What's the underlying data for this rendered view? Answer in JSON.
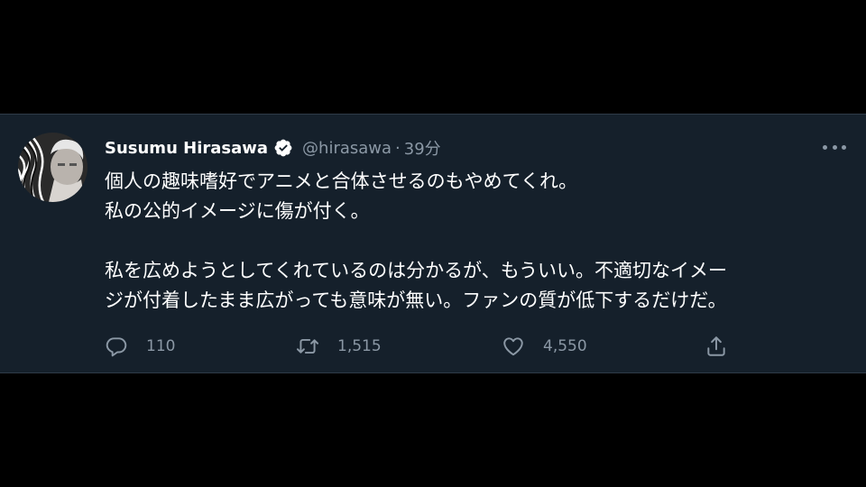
{
  "tweet": {
    "author": {
      "display_name": "Susumu Hirasawa",
      "handle": "@hirasawa",
      "verified": true,
      "avatar": "avatar-photo"
    },
    "separator": "·",
    "time": "39分",
    "lines": [
      "個人の趣味嗜好でアニメと合体させるのもやめてくれ。",
      "私の公的イメージに傷が付く。",
      "",
      "私を広めようとしてくれているのは分かるが、もういい。不適切なイメー",
      "ジが付着したまま広がっても意味が無い。ファンの質が低下するだけだ。"
    ],
    "actions": {
      "reply": {
        "icon": "reply-icon",
        "count": "110"
      },
      "retweet": {
        "icon": "retweet-icon",
        "count": "1,515"
      },
      "like": {
        "icon": "heart-icon",
        "count": "4,550"
      },
      "share": {
        "icon": "share-icon"
      }
    },
    "more_icon": "more-icon"
  },
  "colors": {
    "background": "#000000",
    "card": "#15202b",
    "text_primary": "#ffffff",
    "text_secondary": "#8b98a5",
    "verified": "#ffffff"
  }
}
